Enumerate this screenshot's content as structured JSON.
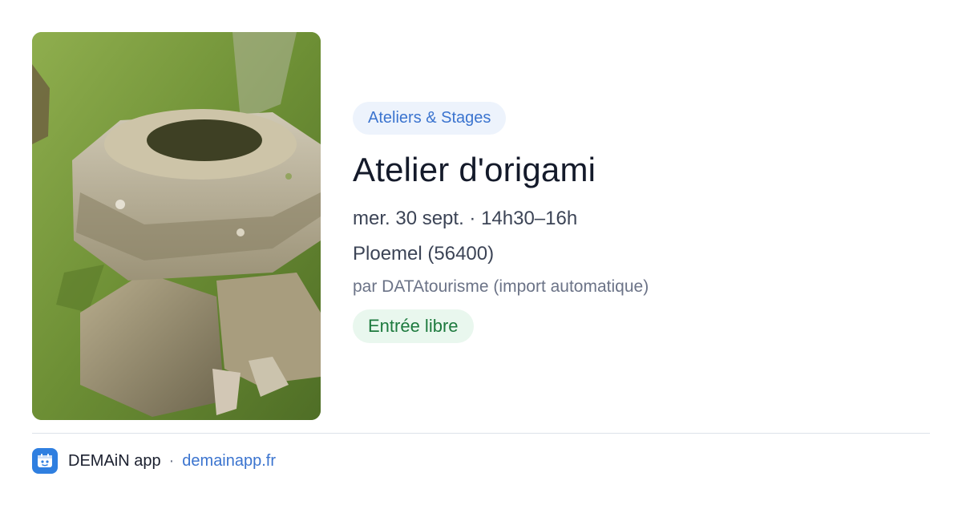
{
  "event": {
    "image": {
      "alt": "",
      "icon": "photo-stone-basin"
    },
    "category": "Ateliers & Stages",
    "title": "Atelier d'origami",
    "date_time": "mer. 30 sept. · 14h30–16h",
    "location": "Ploemel (56400)",
    "author": "par DATAtourisme (import automatique)",
    "price": "Entrée libre"
  },
  "footer": {
    "logo_icon": "demain-app-logo-icon",
    "app_name": "DEMAiN app",
    "separator": "·",
    "site": "demainapp.fr"
  },
  "colors": {
    "category_bg": "#edf3fc",
    "category_text": "#3b74cf",
    "price_bg": "#e9f7ee",
    "price_text": "#1d7a3e",
    "link": "#3b74cf",
    "logo_bg": "#2f7fe0"
  }
}
